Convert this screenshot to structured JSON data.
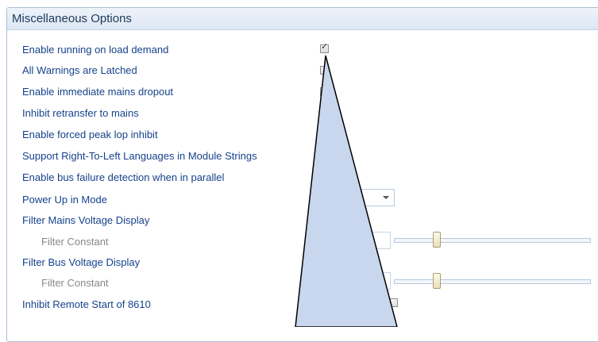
{
  "panel": {
    "title": "Miscellaneous Options"
  },
  "options": [
    {
      "label": "Enable running on load demand",
      "checked": true
    },
    {
      "label": "All Warnings are Latched",
      "checked": false
    },
    {
      "label": "Enable immediate mains dropout",
      "checked": false
    },
    {
      "label": "Inhibit retransfer to mains",
      "checked": false
    },
    {
      "label": "Enable forced peak lop inhibit"
    },
    {
      "label": "Support Right-To-Left Languages in Module Strings"
    },
    {
      "label": "Enable bus failure detection when in parallel"
    },
    {
      "label": "Power Up in Mode"
    },
    {
      "label": "Filter Mains Voltage Display"
    },
    {
      "label": "Filter Constant",
      "slider_value_fraction": 0.22
    },
    {
      "label": "Filter Bus Voltage Display"
    },
    {
      "label": "Filter Constant",
      "slider_value_fraction": 0.22
    },
    {
      "label": "Inhibit Remote Start of 8610"
    }
  ],
  "icons": {
    "checkmark": "checkmark-icon",
    "dropdown": "chevron-down-icon"
  },
  "colors": {
    "label": "#15428b",
    "sublabel": "#888888",
    "callout_fill": "#c8d7ee"
  }
}
